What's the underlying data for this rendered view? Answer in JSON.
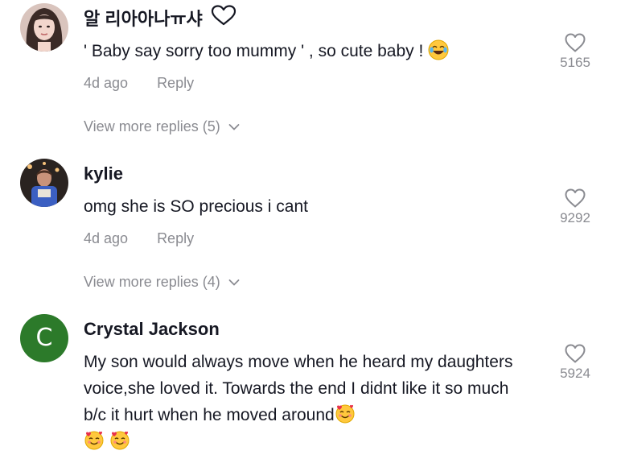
{
  "comments": [
    {
      "username": "알 리아아나ㅠ샤",
      "username_badge": "heart-outline-icon",
      "text": "' Baby say sorry too mummy ' , so cute baby ! ",
      "text_emojis": [
        "face-with-tears-of-joy"
      ],
      "time": "4d ago",
      "reply_label": "Reply",
      "likes": "5165",
      "view_more": "View more replies (5)"
    },
    {
      "username": "kylie",
      "text": "omg she is SO precious i cant",
      "time": "4d ago",
      "reply_label": "Reply",
      "likes": "9292",
      "view_more": "View more replies (4)"
    },
    {
      "username": "Crystal Jackson",
      "avatar_letter": "C",
      "avatar_color": "#2c7a2a",
      "text": "My son would always move when he heard my daughters voice,she loved it. Towards the end I didnt like it so much b/c it hurt when he moved around",
      "text_emojis": [
        "smiling-face-with-hearts",
        "smiling-face-with-hearts",
        "smiling-face-with-hearts"
      ],
      "likes": "5924"
    }
  ],
  "colors": {
    "primary_text": "#161823",
    "secondary_text": "#8a8b91",
    "icon_stroke": "#8a8b91"
  }
}
